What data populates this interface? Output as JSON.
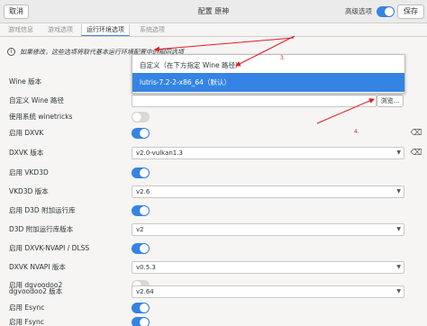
{
  "header": {
    "cancel_label": "取消",
    "title": "配置 原神",
    "advanced_label": "高级选项",
    "advanced_on": true,
    "save_label": "保存"
  },
  "tabs": [
    {
      "label": "游戏信息",
      "active": false
    },
    {
      "label": "游戏选项",
      "active": false
    },
    {
      "label": "运行环境选项",
      "active": true
    },
    {
      "label": "系统选项",
      "active": false
    }
  ],
  "notice": {
    "icon": "info-icon",
    "text": "如果修改，这些选项将取代基本运行环境配置中的相同选项"
  },
  "wine_version": {
    "label": "Wine 版本",
    "dropdown_options": [
      "自定义（在下方指定 Wine 路径）",
      "lutris-7.2-2-x86_64（默认）"
    ],
    "highlighted_index": 1
  },
  "custom_path": {
    "label": "自定义 Wine 路径",
    "value": "",
    "browse_label": "浏览..."
  },
  "rows": [
    {
      "label": "使用系统 winetricks",
      "kind": "toggle",
      "on": false
    },
    {
      "label": "启用 DXVK",
      "kind": "toggle",
      "on": true
    },
    {
      "label": "DXVK 版本",
      "kind": "select",
      "value": "v2.0-vulkan1.3"
    },
    {
      "label": "启用 VKD3D",
      "kind": "toggle",
      "on": true
    },
    {
      "label": "VKD3D 版本",
      "kind": "select",
      "value": "v2.6"
    },
    {
      "label": "启用 D3D 附加运行库",
      "kind": "toggle",
      "on": true
    },
    {
      "label": "D3D 附加运行库版本",
      "kind": "select",
      "value": "v2"
    },
    {
      "label": "启用 DXVK-NVAPI / DLSS",
      "kind": "toggle",
      "on": true
    },
    {
      "label": "DXVK NVAPI 版本",
      "kind": "select",
      "value": "v0.5.3"
    },
    {
      "label": "启用 dgvoodoo2",
      "kind": "toggle",
      "on": false
    },
    {
      "label": "dgvoodoo2 版本",
      "kind": "select",
      "value": "v2.64"
    },
    {
      "label": "启用 Esync",
      "kind": "toggle",
      "on": true
    },
    {
      "label": "启用 Fsync",
      "kind": "toggle",
      "on": true
    }
  ],
  "annotations": [
    "3.",
    "4."
  ],
  "colors": {
    "accent": "#3584e4",
    "annotation": "#e01b24"
  }
}
